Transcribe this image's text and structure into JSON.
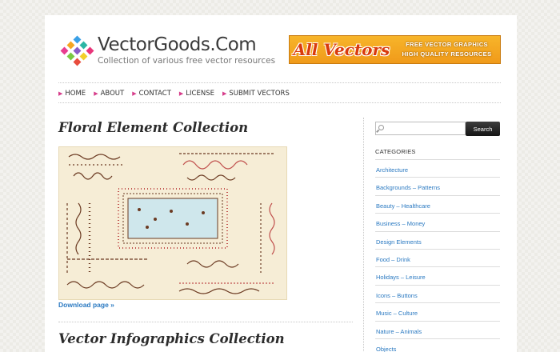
{
  "header": {
    "site_title": "VectorGoods.Com",
    "tagline": "Collection of various free vector resources",
    "banner": {
      "title": "All Vectors",
      "line1": "FREE VECTOR GRAPHICS",
      "line2": "HIGH QUALITY RESOURCES"
    }
  },
  "nav": {
    "items": [
      {
        "label": "HOME"
      },
      {
        "label": "ABOUT"
      },
      {
        "label": "CONTACT"
      },
      {
        "label": "LICENSE"
      },
      {
        "label": "SUBMIT VECTORS"
      }
    ]
  },
  "posts": [
    {
      "title": "Floral Element Collection",
      "link_label": "Download page »"
    },
    {
      "title": "Vector Infographics Collection"
    }
  ],
  "sidebar": {
    "search": {
      "placeholder": "",
      "button_label": "Search"
    },
    "categories_heading": "CATEGORIES",
    "categories": [
      "Architecture",
      "Backgrounds – Patterns",
      "Beauty – Healthcare",
      "Business – Money",
      "Design Elements",
      "Food – Drink",
      "Holidays – Leisure",
      "Icons – Buttons",
      "Music – Culture",
      "Nature – Animals",
      "Objects"
    ]
  },
  "colors": {
    "link": "#2a79c1",
    "nav_bullet": "#d63c8a",
    "banner_orange": "#f09a1a",
    "banner_text": "#d93a0c"
  }
}
